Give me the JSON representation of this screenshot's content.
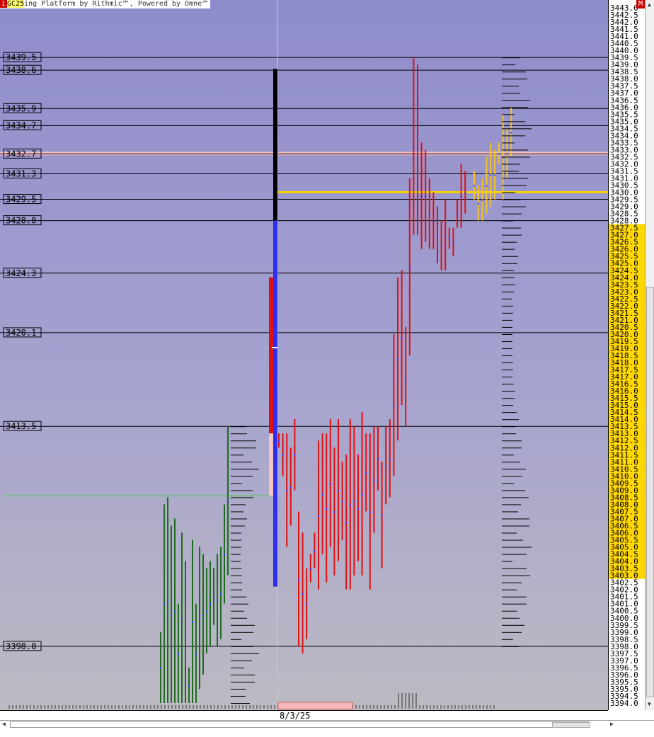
{
  "header": {
    "icon_label": "i",
    "symbol": "GC25",
    "title_text": "ing Platform by Rithmic℠, Powered by Omne℠",
    "menu_button_label": "M"
  },
  "colors": {
    "chart_bg_top": "#8f8ccc",
    "chart_bg_bottom": "#bcbac2",
    "bar_green": "#1f6b1f",
    "bar_red": "#e01010",
    "bar_yellow": "#f2c230",
    "profile": "#000000",
    "value_area_highlight": "#ffd700",
    "poc_line_yellow": "#f2d200",
    "pink_line": "#f6c0c8",
    "ib_black": "#000000",
    "ib_blue": "#2f2ff0"
  },
  "price_axis": {
    "high": 3443.0,
    "low": 3394.0,
    "step": 0.5,
    "value_area_high": 3427.5,
    "value_area_low": 3403.0
  },
  "level_lines": [
    {
      "label": "3439.5",
      "price": 3439.5
    },
    {
      "label": "3438.6",
      "price": 3438.6
    },
    {
      "label": "3435.9",
      "price": 3435.9
    },
    {
      "label": "3434.7",
      "price": 3434.7
    },
    {
      "label": "3432.7",
      "price": 3432.7,
      "highlight": "pink"
    },
    {
      "label": "3431.3",
      "price": 3431.3
    },
    {
      "label": "3429.5",
      "price": 3429.5
    },
    {
      "label": "3428.0",
      "price": 3428.0
    },
    {
      "label": "3424.3",
      "price": 3424.3
    },
    {
      "label": "3420.1",
      "price": 3420.1
    },
    {
      "label": "3413.5",
      "price": 3413.5
    },
    {
      "label": "3398.0",
      "price": 3398.0
    }
  ],
  "poc_price": 3430.0,
  "prior_session_line": 3408.6,
  "time_axis": {
    "date_label": "8/3/25"
  },
  "chart_data": {
    "type": "bar",
    "description_units": "price",
    "sessions": [
      {
        "color": "green",
        "bars": [
          [
            3399.0,
            3394.0
          ],
          [
            3408.0,
            3394.0
          ],
          [
            3408.5,
            3394.0
          ],
          [
            3406.5,
            3394.0
          ],
          [
            3407.0,
            3394.0
          ],
          [
            3401.0,
            3394.0
          ],
          [
            3406.0,
            3394.0
          ],
          [
            3404.0,
            3394.0
          ],
          [
            3396.5,
            3394.0
          ],
          [
            3405.5,
            3394.0
          ],
          [
            3401.0,
            3394.0
          ],
          [
            3405.0,
            3395.0
          ],
          [
            3404.5,
            3396.0
          ],
          [
            3403.5,
            3397.5
          ],
          [
            3404.0,
            3398.0
          ],
          [
            3403.5,
            3399.5
          ],
          [
            3404.5,
            3398.0
          ],
          [
            3405.0,
            3398.5
          ],
          [
            3408.0,
            3401.0
          ],
          [
            3413.5,
            3403.0
          ]
        ]
      },
      {
        "color": "red",
        "bars": [
          [
            3413.0,
            3412.0
          ],
          [
            3413.0,
            3410.0
          ],
          [
            3413.0,
            3405.0
          ],
          [
            3412.0,
            3406.5
          ],
          [
            3414.0,
            3409.0
          ],
          [
            3407.5,
            3398.0
          ],
          [
            3406.0,
            3397.5
          ],
          [
            3403.5,
            3398.5
          ],
          [
            3404.5,
            3402.5
          ],
          [
            3406.0,
            3403.5
          ],
          [
            3412.5,
            3402.0
          ],
          [
            3413.0,
            3404.5
          ],
          [
            3413.0,
            3402.5
          ],
          [
            3414.0,
            3405.0
          ],
          [
            3412.0,
            3403.0
          ],
          [
            3414.0,
            3404.0
          ],
          [
            3411.0,
            3405.5
          ],
          [
            3411.5,
            3402.0
          ],
          [
            3414.0,
            3402.0
          ],
          [
            3413.5,
            3403.0
          ],
          [
            3411.5,
            3404.0
          ],
          [
            3414.5,
            3403.0
          ],
          [
            3413.0,
            3407.5
          ],
          [
            3413.0,
            3402.0
          ],
          [
            3413.5,
            3406.0
          ],
          [
            3413.5,
            3409.0
          ],
          [
            3411.0,
            3403.5
          ],
          [
            3413.5,
            3408.0
          ],
          [
            3414.0,
            3408.5
          ],
          [
            3420.0,
            3410.0
          ],
          [
            3424.0,
            3412.5
          ],
          [
            3424.5,
            3415.0
          ],
          [
            3420.5,
            3413.5
          ],
          [
            3431.0,
            3418.5
          ],
          [
            3439.5,
            3427.0
          ],
          [
            3439.0,
            3427.0
          ],
          [
            3433.5,
            3426.0
          ],
          [
            3433.0,
            3426.5
          ],
          [
            3431.0,
            3426.0
          ],
          [
            3430.0,
            3426.0
          ],
          [
            3429.0,
            3425.0
          ],
          [
            3428.0,
            3424.5
          ],
          [
            3429.5,
            3424.5
          ],
          [
            3427.5,
            3426.0
          ],
          [
            3427.5,
            3425.5
          ],
          [
            3429.5,
            3427.5
          ],
          [
            3432.0,
            3427.5
          ],
          [
            3431.5,
            3428.5
          ]
        ]
      },
      {
        "color": "yellow",
        "bars": [
          [
            3431.5,
            3429.5
          ],
          [
            3430.5,
            3428.0
          ],
          [
            3431.0,
            3428.0
          ],
          [
            3432.5,
            3428.5
          ],
          [
            3433.5,
            3429.0
          ],
          [
            3433.0,
            3429.5
          ],
          [
            3433.5,
            3432.0
          ],
          [
            3435.5,
            3429.5
          ],
          [
            3434.5,
            3431.0
          ],
          [
            3436.0,
            3432.5
          ]
        ]
      }
    ],
    "initial_balance": {
      "high": 3438.7,
      "low": 3402.2,
      "black_low": 3428.0
    }
  }
}
